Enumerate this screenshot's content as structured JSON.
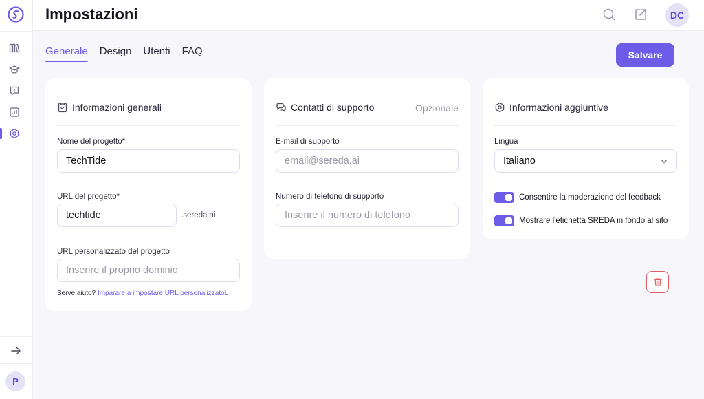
{
  "header": {
    "title": "Impostazioni",
    "avatar_initials": "DC",
    "icons": [
      "search-icon",
      "external-link-icon"
    ]
  },
  "sidebar": {
    "items": [
      {
        "name": "library",
        "icon": "books-icon"
      },
      {
        "name": "learning",
        "icon": "graduation-cap-icon"
      },
      {
        "name": "feedback",
        "icon": "message-alert-icon"
      },
      {
        "name": "analytics",
        "icon": "chart-icon"
      },
      {
        "name": "settings",
        "icon": "hexagon-settings-icon",
        "active": true
      }
    ],
    "collapse_icon": "arrow-right-icon",
    "avatar_initial": "P"
  },
  "tabs": [
    {
      "label": "Generale",
      "active": true
    },
    {
      "label": "Design",
      "active": false
    },
    {
      "label": "Utenti",
      "active": false
    },
    {
      "label": "FAQ",
      "active": false
    }
  ],
  "toolbar": {
    "save_label": "Salvare"
  },
  "general": {
    "title": "Informazioni generali",
    "project_name_label": "Nome del progetto*",
    "project_name_value": "TechTide",
    "project_url_label": "URL del progetto*",
    "project_url_value": "techtide",
    "project_url_suffix": ".sereda.ai",
    "custom_url_label": "URL personalizzato del progetto",
    "custom_url_placeholder": "Inserire il proprio dominio",
    "help_text": "Serve aiuto?",
    "help_link": "Imparare a impostare URL personalizzatoL"
  },
  "support": {
    "title": "Contatti di supporto",
    "optional": "Opzionale",
    "email_label": "E-mail di supporto",
    "email_placeholder": "email@sereda.ai",
    "phone_label": "Numero di telefono di supporto",
    "phone_placeholder": "Inserire il numero di telefono"
  },
  "additional": {
    "title": "Informazioni aggiuntive",
    "language_label": "Lingua",
    "language_value": "Italiano",
    "toggles": [
      {
        "label": "Consentire la moderazione del feedback",
        "on": true
      },
      {
        "label": "Mostrare l'etichetta SREDA in fondo al sito",
        "on": true
      }
    ]
  },
  "colors": {
    "accent": "#6c5ce7",
    "danger": "#e35d66",
    "background": "#f7f7fb"
  }
}
